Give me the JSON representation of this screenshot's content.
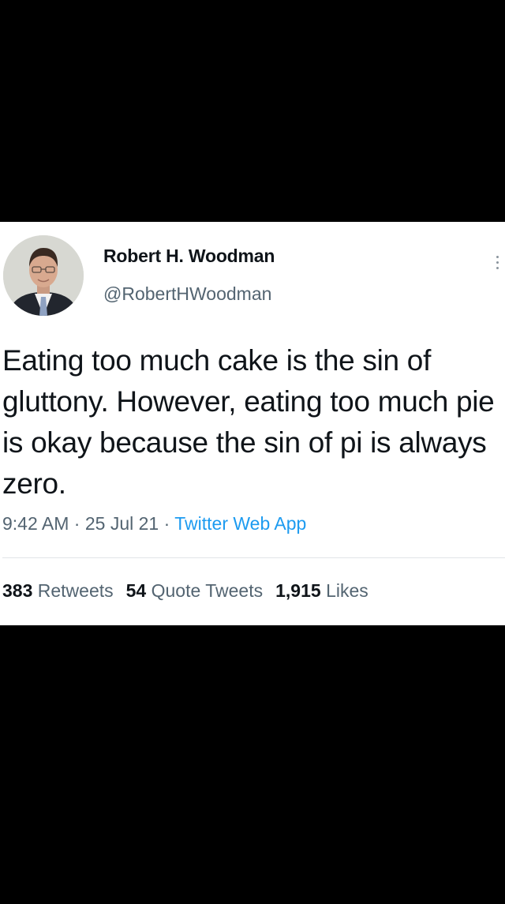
{
  "tweet": {
    "author": {
      "display_name": "Robert H. Woodman",
      "handle": "@RobertHWoodman"
    },
    "text": "Eating too much cake is the sin of gluttony. However, eating too much pie is okay because the sin of pi is always zero.",
    "time": "9:42 AM",
    "separator": "·",
    "date": "25 Jul 21",
    "source": "Twitter Web App",
    "stats": {
      "retweets_count": "383",
      "retweets_label": "Retweets",
      "quotes_count": "54",
      "quotes_label": "Quote Tweets",
      "likes_count": "1,915",
      "likes_label": "Likes"
    }
  },
  "colors": {
    "background": "#000000",
    "card": "#ffffff",
    "text_primary": "#0f1419",
    "text_secondary": "#536471",
    "link": "#1d9bf0"
  },
  "icons": {
    "more": "more-vertical-icon"
  }
}
